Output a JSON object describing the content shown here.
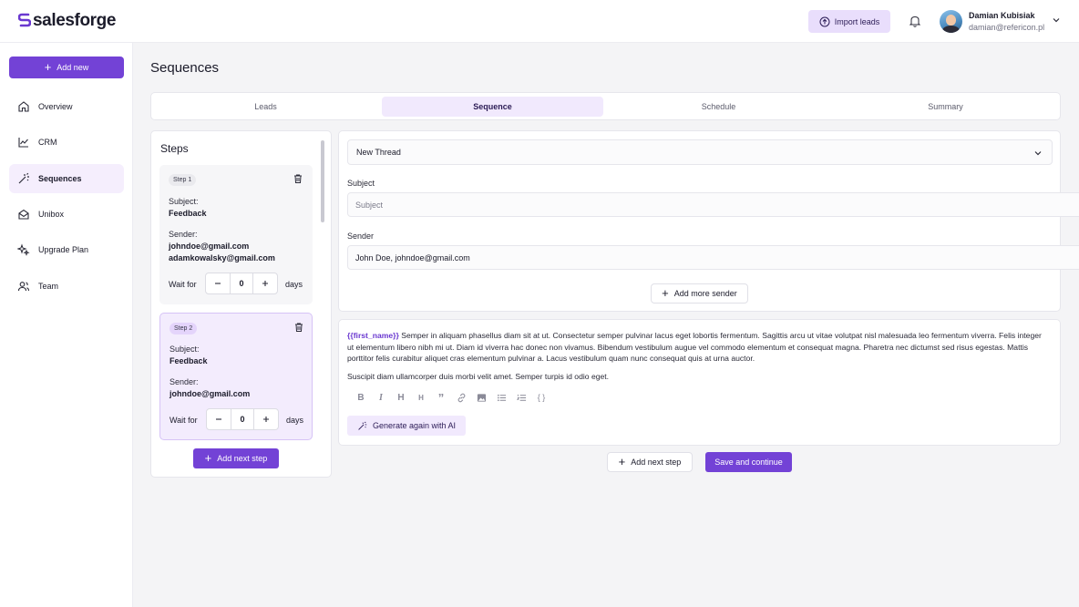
{
  "app": {
    "logo_text": "salesforge"
  },
  "header": {
    "import_label": "Import leads",
    "user_name": "Damian Kubisiak",
    "user_email": "damian@refericon.pl"
  },
  "sidebar": {
    "add_new_label": "Add new",
    "items": [
      {
        "label": "Overview",
        "icon": "home-icon"
      },
      {
        "label": "CRM",
        "icon": "chart-line-icon"
      },
      {
        "label": "Sequences",
        "icon": "magic-wand-icon",
        "active": true
      },
      {
        "label": "Unibox",
        "icon": "mail-open-icon"
      },
      {
        "label": "Upgrade Plan",
        "icon": "sparkles-icon"
      },
      {
        "label": "Team",
        "icon": "users-icon"
      }
    ]
  },
  "page": {
    "title": "Sequences"
  },
  "tabs": [
    {
      "label": "Leads"
    },
    {
      "label": "Sequence",
      "active": true
    },
    {
      "label": "Schedule"
    },
    {
      "label": "Summary"
    }
  ],
  "steps": {
    "title": "Steps",
    "add_next_label": "Add next step",
    "items": [
      {
        "badge": "Step 1",
        "subject_label": "Subject:",
        "subject": "Feedback",
        "sender_label": "Sender:",
        "senders": [
          "johndoe@gmail.com",
          "adamkowalsky@gmail.com"
        ],
        "wait_label": "Wait for",
        "wait_value": "0",
        "days_label": "days"
      },
      {
        "badge": "Step 2",
        "subject_label": "Subject:",
        "subject": "Feedback",
        "sender_label": "Sender:",
        "senders": [
          "johndoe@gmail.com"
        ],
        "wait_label": "Wait for",
        "wait_value": "0",
        "days_label": "days"
      }
    ]
  },
  "thread": {
    "selected": "New Thread",
    "subject_label": "Subject",
    "subject_placeholder": "Subject",
    "sender_label": "Sender",
    "sender_value": "John Doe, johndoe@gmail.com",
    "add_sender_label": "Add more sender"
  },
  "editor": {
    "variable": "{{first_name}}",
    "paragraph1": " Semper in aliquam phasellus diam sit at ut. Consectetur semper pulvinar lacus eget lobortis fermentum. Sagittis arcu ut vitae volutpat nisl malesuada leo fermentum viverra. Felis integer ut elementum libero nibh mi ut. Diam id viverra hac donec non vivamus. Bibendum vestibulum augue vel commodo elementum et consequat magna. Pharetra nec dictumst sed risus egestas. Mattis porttitor felis curabitur aliquet cras elementum pulvinar a. Lacus vestibulum quam nunc consequat quis at urna auctor.",
    "paragraph2": "Suscipit diam ullamcorper duis morbi velit amet. Semper turpis id odio eget.",
    "toolbar": [
      "bold-icon",
      "italic-icon",
      "heading-1-icon",
      "heading-2-icon",
      "quote-icon",
      "link-icon",
      "image-icon",
      "bullet-list-icon",
      "numbered-list-icon",
      "code-braces-icon"
    ],
    "generate_label": "Generate again with AI"
  },
  "actions": {
    "add_next_label": "Add next step",
    "save_label": "Save and continue"
  },
  "colors": {
    "accent": "#7342d6",
    "accent_light": "#f1e9fd"
  }
}
